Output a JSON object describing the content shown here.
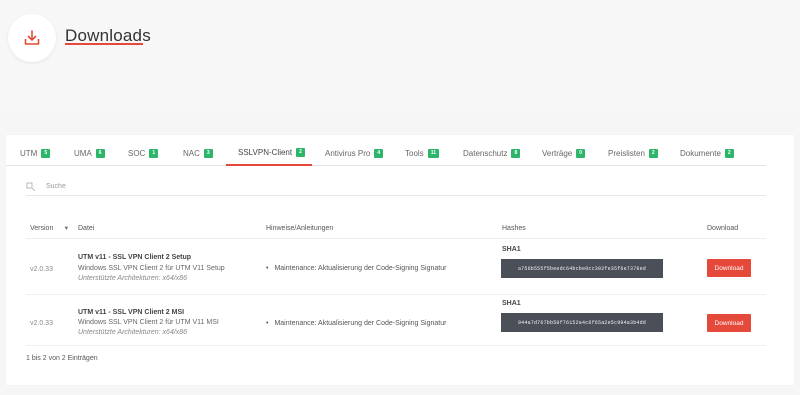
{
  "page": {
    "title": "Downloads",
    "accent": "#e5493a",
    "badge_color": "#2db56a"
  },
  "tabs": [
    {
      "label": "UTM",
      "count": "5"
    },
    {
      "label": "UMA",
      "count": "6"
    },
    {
      "label": "SOC",
      "count": "1"
    },
    {
      "label": "NAC",
      "count": "3"
    },
    {
      "label": "SSLVPN-Client",
      "count": "2"
    },
    {
      "label": "Antivirus Pro",
      "count": "4"
    },
    {
      "label": "Tools",
      "count": "11"
    },
    {
      "label": "Datenschutz",
      "count": "8"
    },
    {
      "label": "Verträge",
      "count": "0"
    },
    {
      "label": "Preislisten",
      "count": "2"
    },
    {
      "label": "Dokumente",
      "count": "2"
    }
  ],
  "search": {
    "placeholder": "Suche"
  },
  "table": {
    "headers": [
      "Version",
      "Datei",
      "Hinweise/Anleitungen",
      "Hashes",
      "Download"
    ],
    "rows": [
      {
        "version": "v2.0.33",
        "title": "UTM v11 - SSL VPN Client 2 Setup",
        "subtitle": "Windows SSL VPN Client 2 für UTM V11 Setup",
        "arch": "Unterstützte Architekturen: x64/x86",
        "hint": "Maintenance: Aktualisierung der Code-Signing Signatur",
        "hash_label": "SHA1",
        "hash": "a756b555f5beedc64bcbe0cc302fe35f6e7378ed",
        "button": "Download"
      },
      {
        "version": "v2.0.33",
        "title": "UTM v11 - SSL VPN Client 2 MSI",
        "subtitle": "Windows SSL VPN Client 2 für UTM V11 MSI",
        "arch": "Unterstützte Architekturen: x64/x86",
        "hint": "Maintenance: Aktualisierung der Code-Signing Signatur",
        "hash_label": "SHA1",
        "hash": "944a7d767bb50f76152a4c6f65a2e5c994a3b4dd",
        "button": "Download"
      }
    ]
  },
  "footer": {
    "info": "1 bis 2 von 2 Einträgen"
  }
}
